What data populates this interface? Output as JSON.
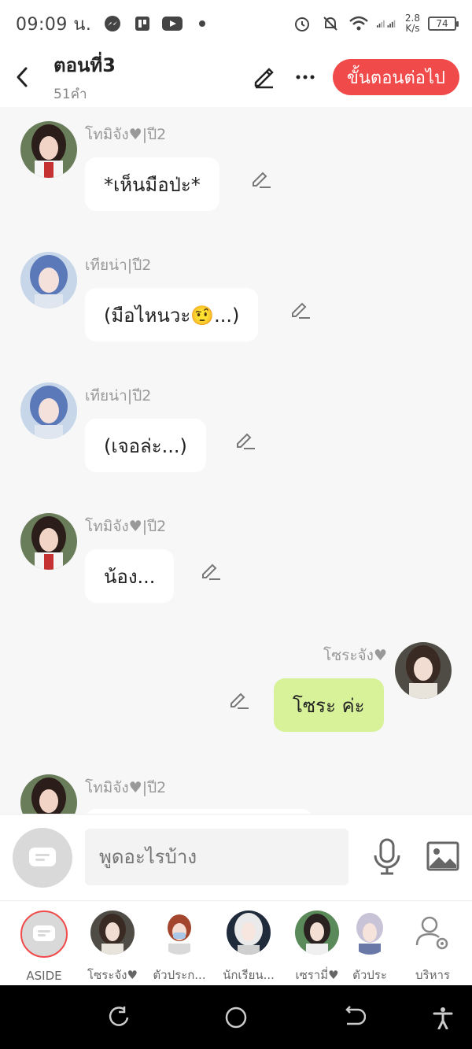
{
  "status_bar": {
    "time": "09:09 น.",
    "speed_top": "2.8",
    "speed_bottom": "K/s",
    "battery": "74"
  },
  "header": {
    "title": "ตอนที่3",
    "word_count": "51คำ",
    "next_button": "ขั้นตอนต่อไป"
  },
  "messages": [
    {
      "sender": "โทมิจัง♥|ปี2",
      "text": "*เห็นมือป่ะ*",
      "side": "left"
    },
    {
      "sender": "เทียน่า|ปี2",
      "text": "(มือไหนวะ🤨...)",
      "side": "left"
    },
    {
      "sender": "เทียน่า|ปี2",
      "text": "(เจอล่ะ...)",
      "side": "left"
    },
    {
      "sender": "โทมิจัง♥|ปี2",
      "text": "น้อง...",
      "side": "left"
    },
    {
      "sender": "โซระจัง♥",
      "text": "โซระ ค่ะ",
      "side": "right"
    },
    {
      "sender": "โทมิจัง♥|ปี2",
      "text": "",
      "side": "left"
    }
  ],
  "input": {
    "placeholder": "พูดอะไรบ้าง"
  },
  "characters": [
    {
      "label": "ASIDE"
    },
    {
      "label": "โซระจัง♥"
    },
    {
      "label": "ตัวประก..."
    },
    {
      "label": "นักเรียน..."
    },
    {
      "label": "เซรามี่♥"
    },
    {
      "label": "ตัวประ"
    },
    {
      "label": "บริหาร"
    }
  ],
  "colors": {
    "accent": "#f04a4a",
    "my_bubble": "#d8f29a",
    "chat_bg": "#f7f7f7"
  }
}
